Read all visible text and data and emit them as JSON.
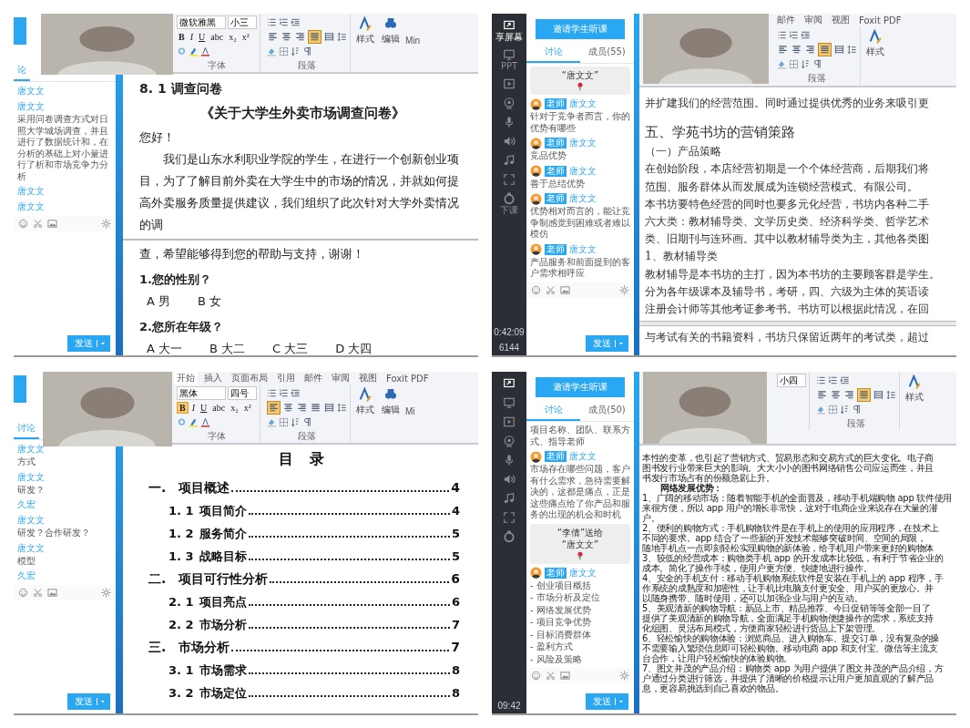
{
  "panels": [
    {
      "chat": {
        "cut_button": true,
        "tabs": [
          {
            "label": "论",
            "selected": true
          }
        ],
        "messages": [
          {
            "kind": "name",
            "name": "唐文文"
          },
          {
            "kind": "name",
            "name": "唐文文",
            "text": "采用问卷调查方式对日照大学城场调查，并且进行了数据统计和，在分析的基础上对小量进行了析和市场竞争力分析"
          },
          {
            "kind": "name",
            "name": "唐文文"
          },
          {
            "kind": "name",
            "name": "唐文文"
          }
        ],
        "send_button": "发送"
      },
      "ribbon": {
        "font": "微软雅黑",
        "size": "小三",
        "format_buttons": [
          {
            "label": "B",
            "selected": false
          },
          {
            "label": "I",
            "selected": false
          },
          {
            "label": "U",
            "selected": false
          },
          {
            "label": "abc",
            "selected": false
          },
          {
            "label": "x₂",
            "selected": false
          },
          {
            "label": "x²",
            "selected": false
          }
        ],
        "font_label": "字体",
        "align": [
          {
            "kind": "left",
            "selected": false
          },
          {
            "kind": "center",
            "selected": false
          },
          {
            "kind": "right",
            "selected": false
          },
          {
            "kind": "justify",
            "selected": true
          },
          {
            "kind": "distributed",
            "selected": false
          }
        ],
        "paragraph_label": "段落",
        "styles_label": "样式",
        "editing_label": "编辑",
        "overflow_label": "Min"
      },
      "document": {
        "kind": "sans",
        "lines": [
          {
            "kind": "heading",
            "text": "8. 1 调查问卷"
          },
          {
            "kind": "title",
            "text": "《关于大学生外卖市场调查问卷》"
          },
          {
            "kind": "para",
            "text": "您好！"
          },
          {
            "kind": "indent",
            "text": "我们是山东水利职业学院的学生，在进行一个创新创业项目，为了了解目前外卖在大学生中的市场的情况，并就如何提高外卖服务质量提供建议，我们组织了此次针对大学外卖情况的调"
          },
          {
            "kind": "break"
          },
          {
            "kind": "para",
            "text": "查，希望能够得到您的帮助与支持，谢谢！"
          },
          {
            "kind": "question",
            "text": "1.您的性别？"
          },
          {
            "kind": "options",
            "items": [
              "A 男",
              "B 女"
            ]
          },
          {
            "kind": "question",
            "text": "2.您所在年级？"
          },
          {
            "kind": "options",
            "items": [
              "A 大一",
              "B 大二",
              "C 大三",
              "D 大四"
            ]
          }
        ]
      }
    },
    {
      "nav": {
        "items": [
          {
            "kind": "share",
            "label": "享屏幕"
          },
          {
            "kind": "ppt",
            "label": "PPT"
          },
          {
            "kind": "video"
          },
          {
            "kind": "camera"
          },
          {
            "kind": "mic"
          },
          {
            "kind": "speaker"
          },
          {
            "kind": "music"
          },
          {
            "kind": "expand"
          },
          {
            "kind": "end",
            "label": "下课"
          }
        ],
        "time": "0:42:09",
        "stats": "6144"
      },
      "chat": {
        "invite_button": "邀请学生听课",
        "tabs": [
          {
            "label": "讨论",
            "selected": true
          },
          {
            "label": "成员(55)",
            "selected": false
          }
        ],
        "messages": [
          {
            "kind": "gift",
            "lines": [
              "“唐文文”"
            ]
          },
          {
            "kind": "teacher",
            "tag": "老师",
            "name": "唐文文",
            "text": "针对于竞争者而言，你的优势有哪些"
          },
          {
            "kind": "teacher",
            "tag": "老师",
            "name": "唐文文",
            "text": "竞品优势"
          },
          {
            "kind": "teacher",
            "tag": "老师",
            "name": "唐文文",
            "text": "善于总结优势"
          },
          {
            "kind": "teacher",
            "tag": "老师",
            "name": "唐文文",
            "text": "优势相对而言的，能让竞争制感觉到困难或者难以模仿"
          },
          {
            "kind": "teacher",
            "tag": "老师",
            "name": "唐文文",
            "text": "产品服务和前面提到的客户需求相呼应"
          }
        ],
        "send_button": "发送"
      },
      "ribbon": {
        "tabs": [
          {
            "label": "邮件",
            "selected": false
          },
          {
            "label": "审阅",
            "selected": false
          },
          {
            "label": "视图",
            "selected": false
          },
          {
            "label": "Foxit PDF",
            "selected": false
          }
        ],
        "align": [
          {
            "kind": "left",
            "selected": false
          },
          {
            "kind": "center",
            "selected": false
          },
          {
            "kind": "right",
            "selected": false
          },
          {
            "kind": "justify",
            "selected": true
          },
          {
            "kind": "distributed",
            "selected": false
          }
        ],
        "paragraph_label": "段落",
        "styles_label": "样式"
      },
      "document": {
        "kind": "serif",
        "lines": [
          {
            "kind": "para",
            "text": "并扩建我们的经营范围。同时通过提供优秀的业务来吸引更"
          },
          {
            "kind": "blank"
          },
          {
            "kind": "heading",
            "text": "五、学苑书坊的营销策路"
          },
          {
            "kind": "para",
            "text": "（一）产品策略"
          },
          {
            "kind": "para",
            "text": "在创始阶段，本店经营初期是一个个体经营商，后期我们将"
          },
          {
            "kind": "para",
            "text": "范围、服务群体从而发展成为连锁经营模式、有限公司。"
          },
          {
            "kind": "para",
            "text": "本书坊要特色经营的同时也要多元化经营，书坊内各种二手"
          },
          {
            "kind": "para",
            "text": "六大类：教材辅导类、文学历史类、经济科学类、哲学艺术"
          },
          {
            "kind": "para",
            "text": "类、旧期刊与连环画。其中以教材辅导类为主，其他各类图"
          },
          {
            "kind": "para",
            "text": "1、教材辅导类"
          },
          {
            "kind": "para",
            "text": "教材辅导是本书坊的主打，因为本书坊的主要顾客群是学生。"
          },
          {
            "kind": "para",
            "text": "分为各年级课本及辅导书，考研，四、六级为主体的英语读"
          },
          {
            "kind": "para",
            "text": "注册会计师等其他考证参考书。书坊可以根据此情况，在回"
          },
          {
            "kind": "break"
          },
          {
            "kind": "para",
            "text": "与考试有关的书籍资料，书坊只保留近两年的考试类，超过"
          }
        ]
      }
    },
    {
      "chat": {
        "cut_button": true,
        "tabs": [
          {
            "label": "讨论",
            "selected": true
          }
        ],
        "messages": [
          {
            "kind": "name",
            "name": "唐文文",
            "text": "方式"
          },
          {
            "kind": "name",
            "name": "唐文文",
            "text": "研发？"
          },
          {
            "kind": "name",
            "name": "久宏"
          },
          {
            "kind": "name",
            "name": "唐文文",
            "text": "研发？合作研发？"
          },
          {
            "kind": "name",
            "name": "唐文文",
            "text": "模型"
          },
          {
            "kind": "name",
            "name": "久宏"
          }
        ],
        "send_button": "发送"
      },
      "ribbon": {
        "tabs": [
          {
            "label": "开始",
            "selected": true
          },
          {
            "label": "插入",
            "selected": false
          },
          {
            "label": "页面布局",
            "selected": false
          },
          {
            "label": "引用",
            "selected": false
          },
          {
            "label": "邮件",
            "selected": false
          },
          {
            "label": "审阅",
            "selected": false
          },
          {
            "label": "视图",
            "selected": false
          },
          {
            "label": "Foxit PDF",
            "selected": false
          }
        ],
        "font": "黑体",
        "size": "四号",
        "format_buttons": [
          {
            "label": "B",
            "selected": true
          },
          {
            "label": "I",
            "selected": false
          },
          {
            "label": "U",
            "selected": false
          },
          {
            "label": "abc",
            "selected": false
          },
          {
            "label": "x₂",
            "selected": false
          },
          {
            "label": "x²",
            "selected": false
          }
        ],
        "font_label": "字体",
        "align": [
          {
            "kind": "left",
            "selected": true
          },
          {
            "kind": "center",
            "selected": false
          },
          {
            "kind": "right",
            "selected": false
          },
          {
            "kind": "justify",
            "selected": false
          },
          {
            "kind": "distributed",
            "selected": false
          }
        ],
        "paragraph_label": "段落",
        "styles_label": "样式",
        "editing_label": "编辑",
        "overflow_label": "Mi"
      },
      "document": {
        "kind": "toc",
        "title": "目 录",
        "lines": [
          {
            "kind": "toc1",
            "num": "一.",
            "text": "项目概述",
            "page": "4"
          },
          {
            "kind": "toc2",
            "num": "1. 1",
            "text": "项目简介",
            "page": "4"
          },
          {
            "kind": "toc2",
            "num": "1. 2",
            "text": "服务简介",
            "page": "5"
          },
          {
            "kind": "toc2",
            "num": "1. 3",
            "text": "战略目标",
            "page": "5"
          },
          {
            "kind": "toc1",
            "num": "二.",
            "text": "项目可行性分析",
            "page": "6"
          },
          {
            "kind": "toc2",
            "num": "2. 1",
            "text": "项目亮点",
            "page": "6"
          },
          {
            "kind": "toc2",
            "num": "2. 2",
            "text": "市场分析",
            "page": "7"
          },
          {
            "kind": "toc1",
            "num": "三.",
            "text": "市场分析",
            "page": "7"
          },
          {
            "kind": "toc2",
            "num": "3. 1",
            "text": "市场需求",
            "page": "8"
          },
          {
            "kind": "toc2",
            "num": "3. 2",
            "text": "市场定位",
            "page": "8"
          }
        ]
      }
    },
    {
      "nav": {
        "items": [
          {
            "kind": "share"
          },
          {
            "kind": "ppt"
          },
          {
            "kind": "video"
          },
          {
            "kind": "camera"
          },
          {
            "kind": "mic"
          },
          {
            "kind": "speaker"
          },
          {
            "kind": "music"
          },
          {
            "kind": "expand"
          },
          {
            "kind": "end"
          }
        ],
        "time": "09:42"
      },
      "chat": {
        "invite_button": "邀请学生听课",
        "tabs": [
          {
            "label": "讨论",
            "selected": true
          },
          {
            "label": "成员(50)",
            "selected": false
          }
        ],
        "messages": [
          {
            "kind": "text",
            "text": "项目名称、团队、联系方式、指导老师"
          },
          {
            "kind": "teacher",
            "tag": "老师",
            "name": "唐文文",
            "text": "市场存在哪些问题，客户有什么需求，急待需要解决的，这都是痛点，正是这些痛点给了你产品和服务的出现的机会和时机"
          },
          {
            "kind": "gift",
            "lines": [
              "“李倩”送给",
              "“唐文文”"
            ]
          },
          {
            "kind": "teacher",
            "tag": "老师",
            "name": "唐文文",
            "items": [
              "- 创业项目概括",
              "- 市场分析及定位",
              "- 网络发展优势",
              "- 项目竞争优势",
              "- 目标消费群体",
              "- 盈利方式",
              "- 风险及策略"
            ]
          }
        ],
        "send_button": "发送"
      },
      "ribbon": {
        "size": "小四",
        "align": [
          {
            "kind": "left",
            "selected": false
          },
          {
            "kind": "center",
            "selected": false
          },
          {
            "kind": "right",
            "selected": false
          },
          {
            "kind": "justify",
            "selected": true
          },
          {
            "kind": "distributed",
            "selected": false
          }
        ],
        "paragraph_label": "段落",
        "styles_label": "样式"
      },
      "document": {
        "kind": "dense",
        "lines": [
          {
            "kind": "para",
            "text": "本性的变革，也引起了营销方式、贸易形态和交易方式的巨大变化。电子商"
          },
          {
            "kind": "para",
            "text": "图书发行业带来巨大的影响。大大小小的图书网络销售公司应运而生，并且"
          },
          {
            "kind": "para",
            "text": "书发行市场占有的份额急剧上升。"
          },
          {
            "kind": "question",
            "text": "网络发展优势："
          },
          {
            "kind": "para",
            "text": "1、广阔的移动市场：随着智能手机的全面普及，移动手机端购物 app 软件使用"
          },
          {
            "kind": "para",
            "text": "来很方便，所以 app 用户的增长非常快，这对于电商企业来说存在大量的潜"
          },
          {
            "kind": "para",
            "text": "户。"
          },
          {
            "kind": "para",
            "text": "2、便利的购物方式：手机购物软件是在手机上的使用的应用程序，在技术上"
          },
          {
            "kind": "para",
            "text": "不同的要求。app 结合了一些新的开发技术能够突破时间、空间的局限，"
          },
          {
            "kind": "para",
            "text": "随地手机点一点即刻轻松实现购物的新体验，给手机用户带来更好的购物体"
          },
          {
            "kind": "para",
            "text": "3、较低的经营成本：购物类手机 app 的开发成本比较低，有利于节省企业的"
          },
          {
            "kind": "para",
            "text": "成本。简化了操作手续，使用户更方便、快捷地进行操作。"
          },
          {
            "kind": "para",
            "text": "4、安全的手机支付：移动手机购物系统软件是安装在手机上的 app 程序，手"
          },
          {
            "kind": "para",
            "text": "作系统的成熟度和加密性，让手机比电脑支付更安全、用户买的更放心。并"
          },
          {
            "kind": "para",
            "text": "以随身携带、随时使用，还可以加强企业与用户的互动。"
          },
          {
            "kind": "para",
            "text": "5、美观清新的购物导航：新品上市、精品推荐、今日促销等等全部一目了"
          },
          {
            "kind": "para",
            "text": "提供了美观清新的购物导航，全面满足手机购物便捷操作的需求，系统支持"
          },
          {
            "kind": "para",
            "text": "化组图、灵活布局模式，方便商家轻松进行货品上下架管理。"
          },
          {
            "kind": "para",
            "text": "6、轻松愉快的购物体验：浏览商品、进入购物车、提交订单，没有复杂的操"
          },
          {
            "kind": "para",
            "text": "不需要输入繁琐信息即可轻松购物。移动电商 app 和支付宝、微信等主流支"
          },
          {
            "kind": "para",
            "text": "台合作，让用户轻松愉快的体验购物。"
          },
          {
            "kind": "para",
            "text": "7、图文并茂的产品介绍：购物类 app 为用户提供了图文并茂的产品介绍，方"
          },
          {
            "kind": "para",
            "text": "户通过分类进行筛选，并提供了清晰的价格提示让用户更加直观的了解产品"
          },
          {
            "kind": "para",
            "text": "息，更容易挑选到自己喜欢的物品。"
          }
        ]
      }
    }
  ]
}
